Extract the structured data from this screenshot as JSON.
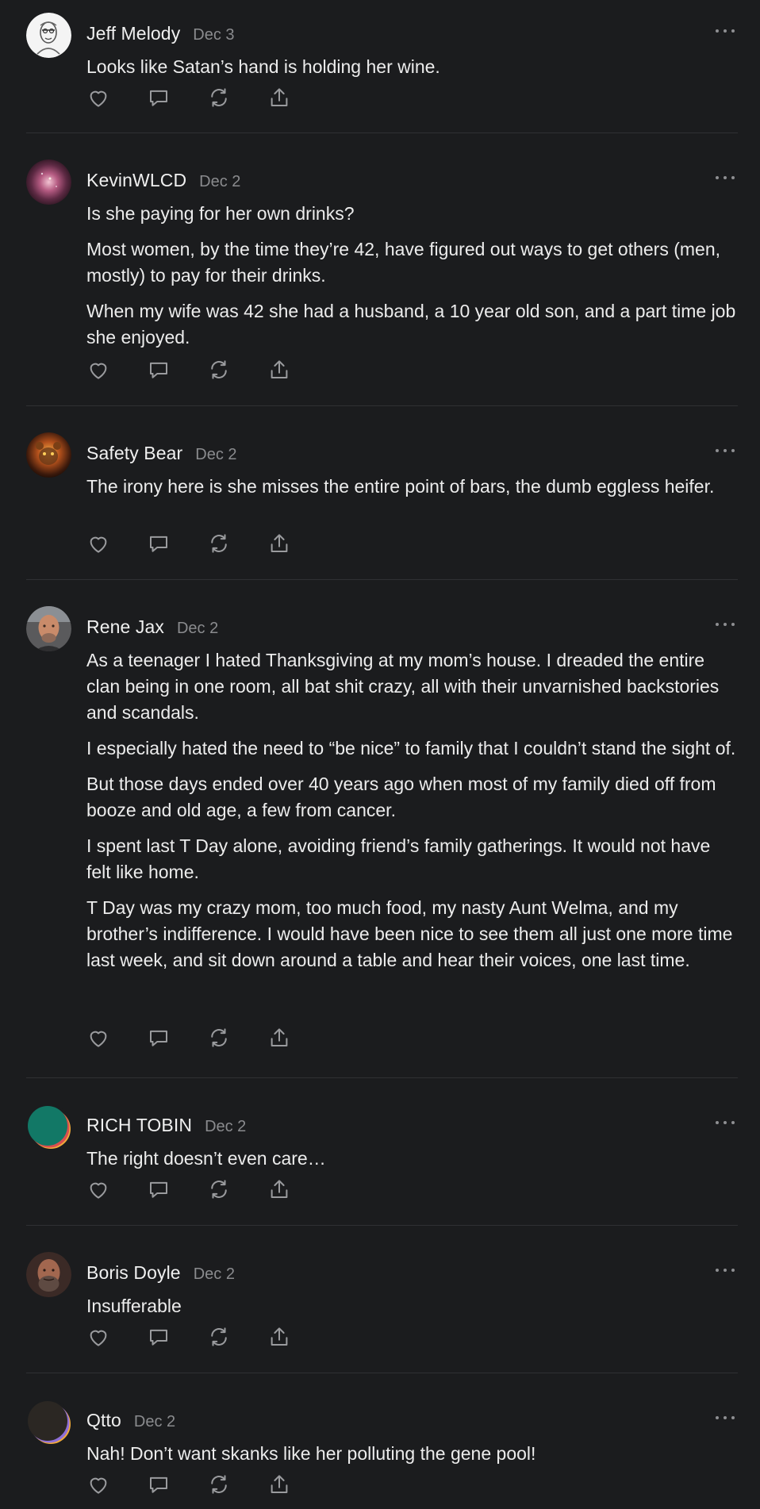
{
  "icons": {
    "more": "more-horizontal-icon",
    "like": "heart-icon",
    "reply": "speech-bubble-icon",
    "restack": "repost-icon",
    "share": "share-upload-icon"
  },
  "colors": {
    "background": "#1b1c1e",
    "text": "#ececec",
    "muted": "#8a8b8e",
    "divider": "#2f3033"
  },
  "comments": [
    {
      "author": "Jeff Melody",
      "date": "Dec 3",
      "paragraphs": [
        "Looks like Satan’s hand is holding her wine."
      ]
    },
    {
      "author": "KevinWLCD",
      "date": "Dec 2",
      "paragraphs": [
        "Is she paying for her own drinks?",
        "Most women, by the time they’re 42, have figured out ways to get others (men, mostly) to pay for their drinks.",
        "When my wife was 42 she had a husband, a 10 year old son, and a part time job she enjoyed."
      ]
    },
    {
      "author": "Safety Bear",
      "date": "Dec 2",
      "paragraphs": [
        "The irony here is she misses the entire point of bars, the dumb eggless heifer."
      ]
    },
    {
      "author": "Rene Jax",
      "date": "Dec 2",
      "paragraphs": [
        "As a teenager I hated Thanksgiving at my mom’s house. I dreaded the entire clan being in one room, all bat shit crazy, all with their unvarnished backstories and scandals.",
        "I especially hated the need to “be nice” to family that I couldn’t stand the sight of.",
        "But those days ended over 40 years ago when most of my family died off from booze and old age, a few from cancer.",
        "I spent last T Day alone, avoiding friend’s family gatherings. It would not have felt like home.",
        "T Day was my crazy mom, too much food, my nasty Aunt Welma, and my brother’s indifference. I would have been nice to see them all just one more time last week, and sit down around a table and hear their voices, one last time."
      ]
    },
    {
      "author": "RICH TOBIN",
      "date": "Dec 2",
      "paragraphs": [
        "The right doesn’t even care…"
      ]
    },
    {
      "author": "Boris Doyle",
      "date": "Dec 2",
      "paragraphs": [
        "Insufferable"
      ]
    },
    {
      "author": "Qtto",
      "date": "Dec 2",
      "paragraphs": [
        "Nah! Don’t want skanks like her polluting the gene pool!"
      ]
    }
  ]
}
